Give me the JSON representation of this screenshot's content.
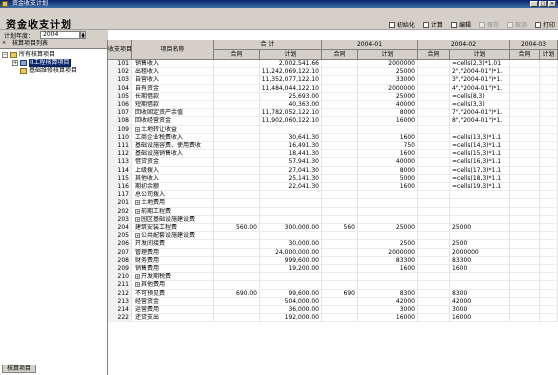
{
  "window": {
    "title": "资金收支计划"
  },
  "page": {
    "title": "资金收支计划"
  },
  "toolbar": {
    "init_label": "初始化",
    "calc_label": "计算",
    "edit_label": "编辑",
    "save_label": "保存",
    "cancel_label": "取消",
    "print_label": "打印"
  },
  "year": {
    "label": "计划年度：",
    "value": "2004"
  },
  "left_panel": {
    "header": "核算项目列表",
    "tree": [
      {
        "label": "所有核算项目",
        "level": 0
      },
      {
        "label": "II工程核算项目",
        "level": 1,
        "selected": true
      },
      {
        "label": "基础维修核算项目",
        "level": 1
      }
    ],
    "tab_label": "核算项目"
  },
  "grid": {
    "headers": {
      "code": "收支项目",
      "name": "项目名称",
      "total": "合 计",
      "p1": "2004-01",
      "p2": "2004-02",
      "p3": "2004-03",
      "contract": "合同",
      "plan": "计划"
    },
    "rows": [
      {
        "code": "101",
        "name": "销售收入",
        "hj": "",
        "hp": "2,002,541.66",
        "h1": "",
        "p1": "2000000",
        "h2": "",
        "p2": "=cells(2,3)*1.01",
        "h3": "",
        "p3": ""
      },
      {
        "code": "102",
        "name": "出租收入",
        "hj": "",
        "hp": "11,242,069,122.10",
        "h1": "",
        "p1": "25000",
        "h2": "",
        "p2": "2\",\"2004-01\")*1.",
        "h3": "",
        "p3": ""
      },
      {
        "code": "103",
        "name": "自营收入",
        "hj": "",
        "hp": "11,352,077,122.10",
        "h1": "",
        "p1": "33000",
        "h2": "",
        "p2": "3\",\"2004-01\")*1.",
        "h3": "",
        "p3": ""
      },
      {
        "code": "104",
        "name": "自有资金",
        "hj": "",
        "hp": "11,484,044,122.10",
        "h1": "",
        "p1": "2000000",
        "h2": "",
        "p2": "4\",\"2004-01\")*1.",
        "h3": "",
        "p3": ""
      },
      {
        "code": "105",
        "name": "长期借款",
        "hj": "",
        "hp": "25,693.00",
        "h1": "",
        "p1": "25000",
        "h2": "",
        "p2": "=cells(8,3)",
        "h3": "",
        "p3": ""
      },
      {
        "code": "106",
        "name": "短期借款",
        "hj": "",
        "hp": "40,363.00",
        "h1": "",
        "p1": "40000",
        "h2": "",
        "p2": "=cells(3,3)",
        "h3": "",
        "p3": ""
      },
      {
        "code": "107",
        "name": "回收固定资产余值",
        "hj": "",
        "hp": "11,782,052,122.10",
        "h1": "",
        "p1": "8000",
        "h2": "",
        "p2": "7\",\"2004-01\")*1.",
        "h3": "",
        "p3": ""
      },
      {
        "code": "108",
        "name": "回收经营资金",
        "hj": "",
        "hp": "11,902,060,122.10",
        "h1": "",
        "p1": "16000",
        "h2": "",
        "p2": "8\",\"2004-01\")*1.",
        "h3": "",
        "p3": ""
      },
      {
        "code": "109",
        "name": "土地转让收益",
        "hj": "",
        "hp": "",
        "h1": "",
        "p1": "",
        "h2": "",
        "p2": "",
        "h3": "",
        "p3": "",
        "expand": true
      },
      {
        "code": "110",
        "name": "工商企业税费收入",
        "hj": "",
        "hp": "30,641.30",
        "h1": "",
        "p1": "1600",
        "h2": "",
        "p2": "=cells(13,3)*1.1",
        "h3": "",
        "p3": ""
      },
      {
        "code": "111",
        "name": "基础设施容费、使用费收",
        "hj": "",
        "hp": "16,491.30",
        "h1": "",
        "p1": "750",
        "h2": "",
        "p2": "=cells(14,3)*1.1",
        "h3": "",
        "p3": ""
      },
      {
        "code": "112",
        "name": "基础设施销售收入",
        "hj": "",
        "hp": "18,441.30",
        "h1": "",
        "p1": "1600",
        "h2": "",
        "p2": "=cells(15,3)*1.1",
        "h3": "",
        "p3": ""
      },
      {
        "code": "113",
        "name": "借贷资金",
        "hj": "",
        "hp": "57,941.30",
        "h1": "",
        "p1": "40000",
        "h2": "",
        "p2": "=cells(16,3)*1.1",
        "h3": "",
        "p3": ""
      },
      {
        "code": "114",
        "name": "上级拨入",
        "hj": "",
        "hp": "27,041.30",
        "h1": "",
        "p1": "8000",
        "h2": "",
        "p2": "=cells(17,3)*1.1",
        "h3": "",
        "p3": ""
      },
      {
        "code": "115",
        "name": "其他收入",
        "hj": "",
        "hp": "25,141.30",
        "h1": "",
        "p1": "5000",
        "h2": "",
        "p2": "=cells(18,3)*1.1",
        "h3": "",
        "p3": ""
      },
      {
        "code": "116",
        "name": "期初余额",
        "hj": "",
        "hp": "22,041.30",
        "h1": "",
        "p1": "1600",
        "h2": "",
        "p2": "=cells(19,3)*1.1",
        "h3": "",
        "p3": ""
      },
      {
        "code": "117",
        "name": "总公司拨入",
        "hj": "",
        "hp": "",
        "h1": "",
        "p1": "",
        "h2": "",
        "p2": "",
        "h3": "",
        "p3": ""
      },
      {
        "code": "201",
        "name": "土地费用",
        "hj": "",
        "hp": "",
        "h1": "",
        "p1": "",
        "h2": "",
        "p2": "",
        "h3": "",
        "p3": "",
        "expand": true
      },
      {
        "code": "202",
        "name": "前期工程费",
        "hj": "",
        "hp": "",
        "h1": "",
        "p1": "",
        "h2": "",
        "p2": "",
        "h3": "",
        "p3": "",
        "expand": true
      },
      {
        "code": "203",
        "name": "园区基础设施建设费",
        "hj": "",
        "hp": "",
        "h1": "",
        "p1": "",
        "h2": "",
        "p2": "",
        "h3": "",
        "p3": "",
        "expand": true
      },
      {
        "code": "204",
        "name": "建筑安装工程费",
        "hj": "560.00",
        "hp": "300,000.00",
        "h1": "560",
        "p1": "25000",
        "h2": "",
        "p2": "25000",
        "h3": "",
        "p3": ""
      },
      {
        "code": "205",
        "name": "公共配套设施建设费",
        "hj": "",
        "hp": "",
        "h1": "",
        "p1": "",
        "h2": "",
        "p2": "",
        "h3": "",
        "p3": "",
        "expand": true
      },
      {
        "code": "206",
        "name": "开发间接费",
        "hj": "",
        "hp": "30,000.00",
        "h1": "",
        "p1": "2500",
        "h2": "",
        "p2": "2500",
        "h3": "",
        "p3": ""
      },
      {
        "code": "207",
        "name": "管理费用",
        "hj": "",
        "hp": "24,000,000.00",
        "h1": "",
        "p1": "2000000",
        "h2": "",
        "p2": "2000000",
        "h3": "",
        "p3": ""
      },
      {
        "code": "208",
        "name": "财务费用",
        "hj": "",
        "hp": "999,600.00",
        "h1": "",
        "p1": "83300",
        "h2": "",
        "p2": "83300",
        "h3": "",
        "p3": ""
      },
      {
        "code": "209",
        "name": "销售费用",
        "hj": "",
        "hp": "19,200.00",
        "h1": "",
        "p1": "1600",
        "h2": "",
        "p2": "1600",
        "h3": "",
        "p3": ""
      },
      {
        "code": "210",
        "name": "开发期税费",
        "hj": "",
        "hp": "",
        "h1": "",
        "p1": "",
        "h2": "",
        "p2": "",
        "h3": "",
        "p3": "",
        "expand": true
      },
      {
        "code": "211",
        "name": "其他费用",
        "hj": "",
        "hp": "",
        "h1": "",
        "p1": "",
        "h2": "",
        "p2": "",
        "h3": "",
        "p3": "",
        "expand": true
      },
      {
        "code": "212",
        "name": "不可预见费",
        "hj": "690.00",
        "hp": "99,600.00",
        "h1": "690",
        "p1": "8300",
        "h2": "",
        "p2": "8300",
        "h3": "",
        "p3": ""
      },
      {
        "code": "213",
        "name": "经营资金",
        "hj": "",
        "hp": "504,000.00",
        "h1": "",
        "p1": "42000",
        "h2": "",
        "p2": "42000",
        "h3": "",
        "p3": ""
      },
      {
        "code": "214",
        "name": "运营费用",
        "hj": "",
        "hp": "36,000.00",
        "h1": "",
        "p1": "3000",
        "h2": "",
        "p2": "3000",
        "h3": "",
        "p3": ""
      },
      {
        "code": "222",
        "name": "还贷支出",
        "hj": "",
        "hp": "192,000.00",
        "h1": "",
        "p1": "16000",
        "h2": "",
        "p2": "16000",
        "h3": "",
        "p3": ""
      }
    ]
  }
}
